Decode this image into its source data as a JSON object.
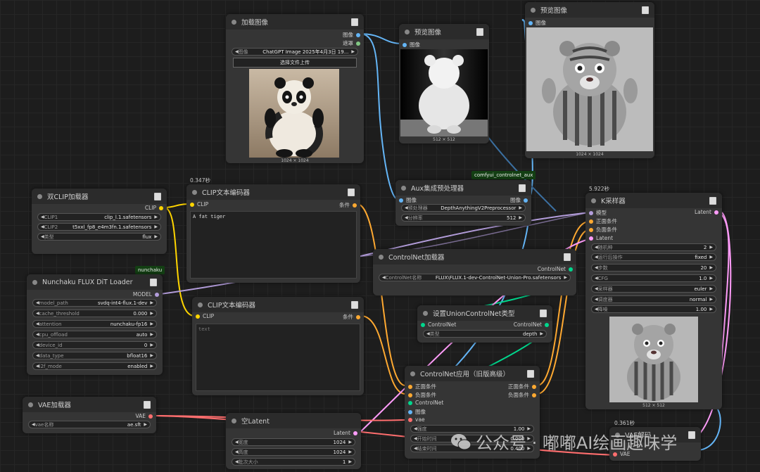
{
  "nodes": {
    "load_image": {
      "title": "加载图像",
      "out_image": "图像",
      "out_mask": "遮罩",
      "widget_label": "图像",
      "widget_value": "ChatGPT Image 2025年4月3日 19...",
      "upload_label": "选择文件上传",
      "size": "1024 × 1024"
    },
    "preview_depth": {
      "title": "预览图像",
      "in_image": "图像",
      "size": "512 × 512"
    },
    "preview_main": {
      "title": "预览图像",
      "in_image": "图像",
      "size": "1024 × 1024"
    },
    "dual_clip": {
      "title": "双CLIP加载器",
      "out_clip": "CLIP",
      "widgets": [
        {
          "label": "CLIP1",
          "value": "clip_l.1.safetensors"
        },
        {
          "label": "CLIP2",
          "value": "t5xxl_fp8_e4m3fn.1.safetensors"
        },
        {
          "label": "类型",
          "value": "flux"
        }
      ]
    },
    "clip_pos": {
      "title": "CLIP文本编码器",
      "timing": "0.347秒",
      "in_clip": "CLIP",
      "out_cond": "条件",
      "text": "A fat tiger"
    },
    "clip_neg": {
      "title": "CLIP文本编码器",
      "in_clip": "CLIP",
      "out_cond": "条件",
      "placeholder": "text"
    },
    "aux": {
      "title": "Aux集成预处理器",
      "badge": "comfyui_controlnet_aux",
      "in_image": "图像",
      "out_image": "图像",
      "widgets": [
        {
          "label": "预处理器",
          "value": "DepthAnythingV2Preprocessor"
        },
        {
          "label": "分辨率",
          "value": "512"
        }
      ]
    },
    "nunchaku": {
      "title": "Nunchaku FLUX DiT Loader",
      "badge": "nunchaku",
      "out_model": "MODEL",
      "widgets": [
        {
          "label": "model_path",
          "value": "svdq-int4-flux.1-dev"
        },
        {
          "label": "cache_threshold",
          "value": "0.000"
        },
        {
          "label": "attention",
          "value": "nunchaku-fp16"
        },
        {
          "label": "cpu_offload",
          "value": "auto"
        },
        {
          "label": "device_id",
          "value": "0"
        },
        {
          "label": "data_type",
          "value": "bfloat16"
        },
        {
          "label": "i2f_mode",
          "value": "enabled"
        }
      ]
    },
    "cn_loader": {
      "title": "ControlNet加载器",
      "out_cn": "ControlNet",
      "widget_label": "ControlNet名称",
      "widget_value": "FLUX\\FLUX.1-dev-ControlNet-Union-Pro.safetensors"
    },
    "union_type": {
      "title": "设置UnionControlNet类型",
      "in_cn": "ControlNet",
      "out_cn": "ControlNet",
      "widget_label": "类型",
      "widget_value": "depth"
    },
    "ksampler": {
      "title": "K采样器",
      "timing": "5.922秒",
      "in_model": "模型",
      "in_pos": "正面条件",
      "in_neg": "负面条件",
      "in_latent": "Latent",
      "out_latent": "Latent",
      "widgets": [
        {
          "label": "随机种",
          "value": "2"
        },
        {
          "label": "运行后操作",
          "value": "fixed"
        },
        {
          "label": "步数",
          "value": "20"
        },
        {
          "label": "CFG",
          "value": "1.0"
        },
        {
          "label": "采样器",
          "value": "euler"
        },
        {
          "label": "调度器",
          "value": "normal"
        },
        {
          "label": "降噪",
          "value": "1.00"
        }
      ],
      "size": "512 × 512"
    },
    "cn_apply": {
      "title": "ControlNet应用（旧版高级）",
      "in_pos": "正面条件",
      "in_neg": "负面条件",
      "in_cn": "ControlNet",
      "in_image": "图像",
      "in_vae": "vae",
      "out_pos": "正面条件",
      "out_neg": "负面条件",
      "widgets": [
        {
          "label": "强度",
          "value": "1.00"
        },
        {
          "label": "开始时间",
          "value": "0.000"
        },
        {
          "label": "结束时间",
          "value": "0.400"
        }
      ]
    },
    "vae_loader": {
      "title": "VAE加载器",
      "out_vae": "VAE",
      "widget_label": "vae名称",
      "widget_value": "ae.sft"
    },
    "empty_latent": {
      "title": "空Latent",
      "out_latent": "Latent",
      "widgets": [
        {
          "label": "宽度",
          "value": "1024"
        },
        {
          "label": "高度",
          "value": "1024"
        },
        {
          "label": "批次大小",
          "value": "1"
        }
      ]
    },
    "vae_decode": {
      "title": "VAE解码",
      "timing": "0.361秒",
      "in_vae": "VAE"
    }
  },
  "watermark": "公众号 · 嘟嘟AI绘画趣味学",
  "colors": {
    "image": "#64b5f6",
    "mask": "#81c784",
    "clip": "#ffd500",
    "cond": "#ffa931",
    "model": "#b39ddb",
    "latent": "#ff9cf9",
    "vae": "#ff6e6e",
    "controlnet": "#00d78d"
  }
}
